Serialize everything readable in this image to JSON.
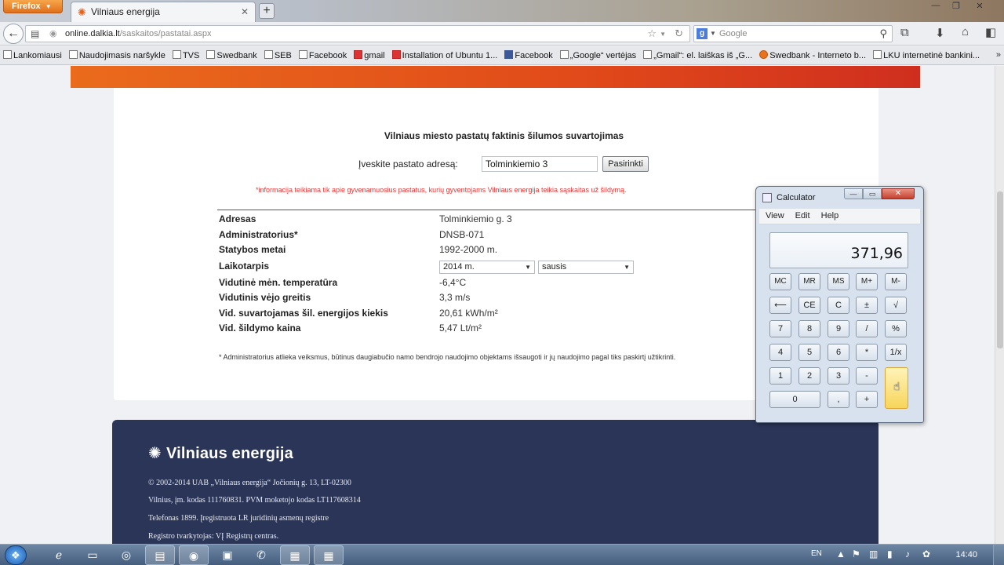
{
  "browser": {
    "app_button": "Firefox",
    "tab_title": "Vilniaus energija",
    "url_domain": "online.dalkia.lt",
    "url_path": "/saskaitos/pastatai.aspx",
    "search_placeholder": "Google",
    "bookmarks": [
      "Lankomiausi",
      "Naudojimasis naršykle",
      "TVS",
      "Swedbank",
      "SEB",
      "Facebook",
      "gmail",
      "Installation of Ubuntu 1...",
      "Facebook",
      "„Google“ vertėjas",
      "„Gmail“: el. laiškas iš „G...",
      "Swedbank - Interneto b...",
      "LKU internetinė bankini..."
    ]
  },
  "page": {
    "title": "Vilniaus miesto pastatų faktinis šilumos suvartojimas",
    "address_label": "Įveskite pastato adresą:",
    "address_value": "Tolminkiemio 3",
    "choose_button": "Pasirinkti",
    "info_note": "*informacija teikiama tik apie gyvenamuosius pastatus, kurių gyventojams Vilniaus energija teikia sąskaitas už šildymą.",
    "rows": [
      {
        "label": "Adresas",
        "value": "Tolminkiemio g. 3"
      },
      {
        "label": "Administratorius*",
        "value": "DNSB-071"
      },
      {
        "label": "Statybos metai",
        "value": "1992-2000 m."
      },
      {
        "label": "Laikotarpis",
        "value": ""
      },
      {
        "label": "Vidutinė mėn. temperatūra",
        "value": "-6,4°C"
      },
      {
        "label": "Vidutinis vėjo greitis",
        "value": "3,3 m/s"
      },
      {
        "label": "Vid. suvartojamas šil. energijos kiekis",
        "value": "20,61 kWh/m²"
      },
      {
        "label": "Vid. šildymo kaina",
        "value": "5,47 Lt/m²"
      }
    ],
    "year_select": "2014 m.",
    "month_select": "sausis",
    "footnote": "* Administratorius atlieka veiksmus, būtinus daugiabučio namo bendrojo naudojimo objektams išsaugoti ir jų naudojimo pagal tiks paskirtį užtikrinti."
  },
  "footer": {
    "logo_text": "Vilniaus energija",
    "lines": [
      "© 2002-2014 UAB „Vilniaus energija“ Jočionių g. 13, LT-02300",
      "Vilnius, įm. kodas 111760831. PVM moketojo kodas LT117608314",
      "Telefonas 1899. Įregistruota LR juridinių asmenų registre",
      "Registro tvarkytojas: VĮ Registrų centras."
    ]
  },
  "calculator": {
    "title": "Calculator",
    "menu": [
      "View",
      "Edit",
      "Help"
    ],
    "display": "371,96",
    "keys": {
      "mc": "MC",
      "mr": "MR",
      "ms": "MS",
      "mplus": "M+",
      "mminus": "M-",
      "back": "⟵",
      "ce": "CE",
      "c": "C",
      "pm": "±",
      "sqrt": "√",
      "k7": "7",
      "k8": "8",
      "k9": "9",
      "div": "/",
      "pct": "%",
      "k4": "4",
      "k5": "5",
      "k6": "6",
      "mul": "*",
      "inv": "1/x",
      "k1": "1",
      "k2": "2",
      "k3": "3",
      "sub": "-",
      "k0": "0",
      "dot": ",",
      "add": "+"
    }
  },
  "taskbar": {
    "lang": "EN",
    "clock": "14:40"
  },
  "colors": {
    "footer_bg": "#2b3557",
    "note_red": "#e33333",
    "brand_orange": "#e5621a"
  }
}
